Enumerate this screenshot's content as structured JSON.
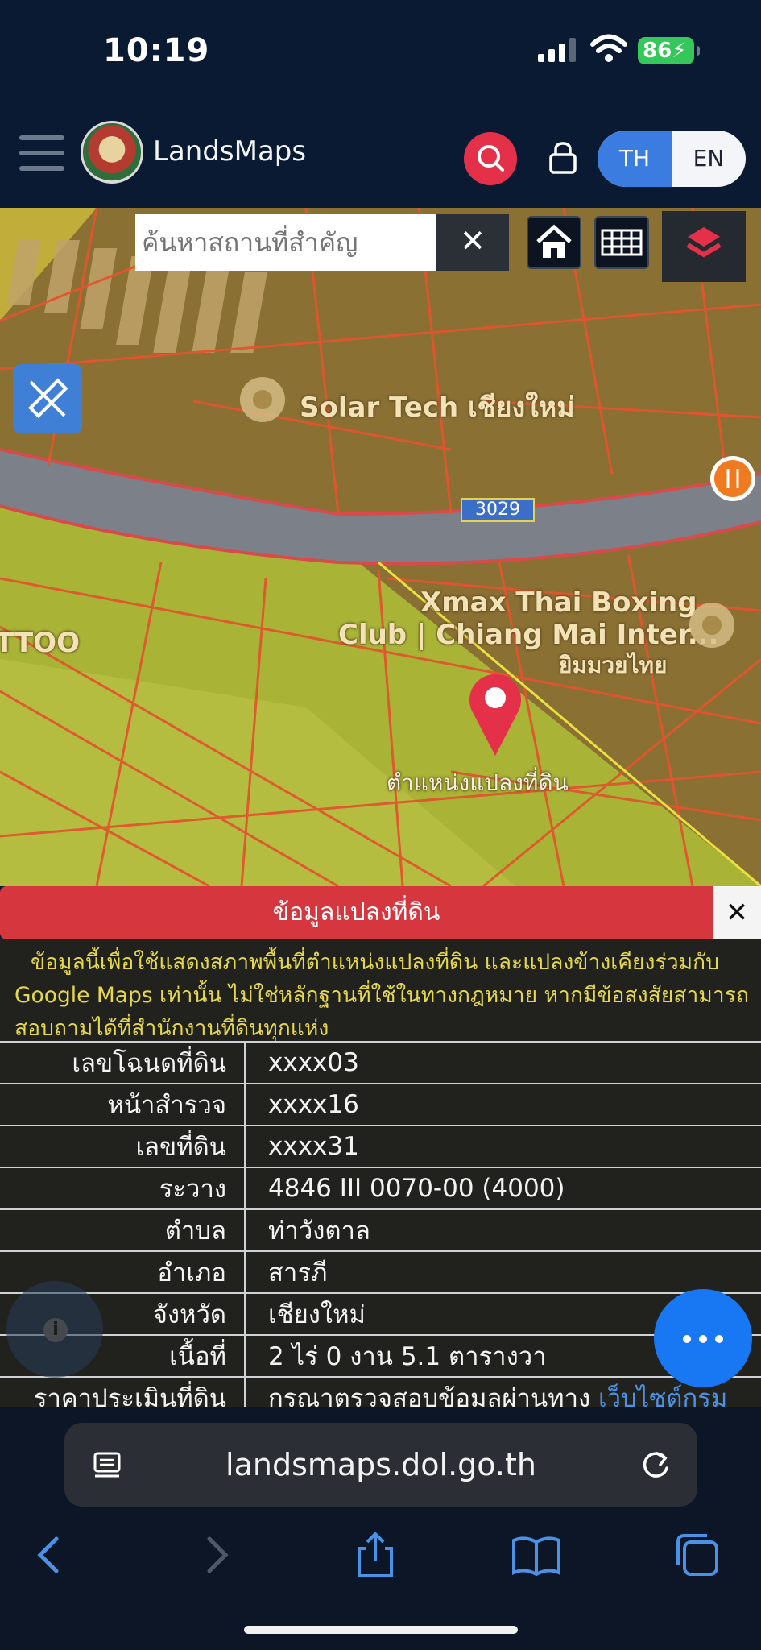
{
  "status": {
    "time": "10:19",
    "battery": "86"
  },
  "header": {
    "brand": "LandsMaps",
    "lang_th": "TH",
    "lang_en": "EN"
  },
  "map": {
    "search_placeholder": "ค้นหาสถานที่สำคัญ",
    "clear_label": "✕",
    "poi_solar": "Solar Tech เชียงใหม่",
    "road_number": "3029",
    "poi_boxing_1": "Xmax Thai Boxing",
    "poi_boxing_2": "Club | Chiang Mai Inter...",
    "poi_boxing_3": "ยิมมวยไทย",
    "poi_partial_left": "TTOO",
    "pin_caption": "ตำแหน่งแปลงที่ดิน"
  },
  "panel": {
    "title": "ข้อมูลแปลงที่ดิน",
    "close_label": "✕",
    "disclaimer": "ข้อมูลนี้เพื่อใช้แสดงสภาพพื้นที่ตำแหน่งแปลงที่ดิน และแปลงข้างเคียงร่วมกับ Google Maps เท่านั้น ไม่ใช่หลักฐานที่ใช้ในทางกฎหมาย หากมีข้อสงสัยสามารถสอบถามได้ที่สำนักงานที่ดินทุกแห่ง",
    "rows": [
      {
        "label": "เลขโฉนดที่ดิน",
        "value": "xxxx03"
      },
      {
        "label": "หน้าสำรวจ",
        "value": "xxxx16"
      },
      {
        "label": "เลขที่ดิน",
        "value": "xxxx31"
      },
      {
        "label": "ระวาง",
        "value": "4846 III 0070-00 (4000)"
      },
      {
        "label": "ตำบล",
        "value": "ท่าวังตาล"
      },
      {
        "label": "อำเภอ",
        "value": "สารภี"
      },
      {
        "label": "จังหวัด",
        "value": "เชียงใหม่"
      },
      {
        "label": "เนื้อที่",
        "value": "2 ไร่ 0 งาน 5.1 ตารางวา"
      },
      {
        "label": "ราคาประเมินที่ดิน",
        "value": "กรุณาตรวจสอบข้อมูลผ่านทาง",
        "link": "เว็บไซต์กรม"
      }
    ]
  },
  "browser": {
    "url": "landsmaps.dol.go.th"
  },
  "colors": {
    "accent_blue": "#3b7ce0",
    "brand_red": "#e5304a",
    "panel_red": "#d6373f",
    "warning_yellow": "#e5d84d",
    "fab_blue": "#1877f2"
  }
}
